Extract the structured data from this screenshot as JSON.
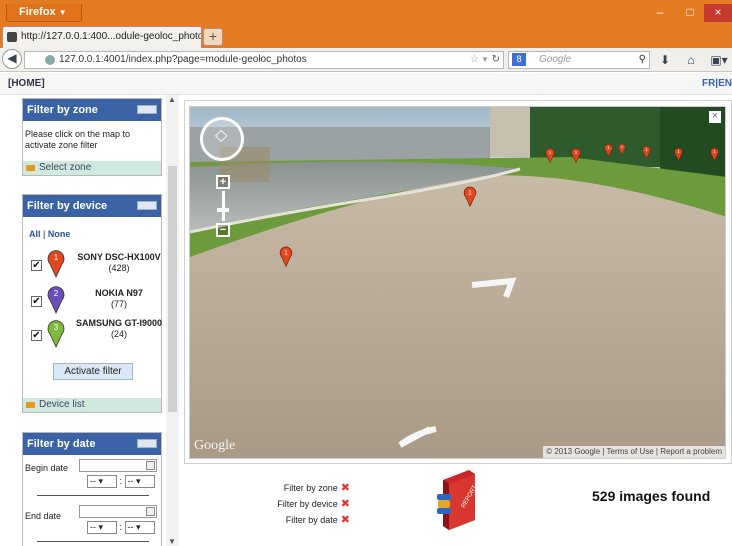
{
  "browser": {
    "app_button": "Firefox",
    "tab_title": "http://127.0.0.1:400...odule-geoloc_photos",
    "new_tab": "+",
    "url": "127.0.0.1:4001/index.php?page=module-geoloc_photos",
    "search_placeholder": "Google",
    "window_controls": {
      "minimize": "–",
      "maximize": "□",
      "close": "×"
    }
  },
  "site": {
    "home_link": "[HOME]",
    "lang_links": "FR|EN"
  },
  "zone_filter": {
    "title": "Filter by zone",
    "text": "Please click on the map to activate zone filter",
    "footer": "Select zone"
  },
  "device_filter": {
    "title": "Filter by device",
    "all": "All",
    "sep": "|",
    "none": "None",
    "devices": [
      {
        "number": "1",
        "name": "SONY DSC-HX100V",
        "count": "(428)",
        "color": "#e4461e",
        "checked": true
      },
      {
        "number": "2",
        "name": "NOKIA N97",
        "count": "(77)",
        "color": "#6b4fb8",
        "checked": true
      },
      {
        "number": "3",
        "name": "SAMSUNG GT-I9000",
        "count": "(24)",
        "color": "#7fb93a",
        "checked": true
      }
    ],
    "activate_button": "Activate filter",
    "footer": "Device list"
  },
  "date_filter": {
    "title": "Filter by date",
    "begin_label": "Begin date",
    "end_label": "End date",
    "select_placeholder": "--",
    "time_sep": ":"
  },
  "streetview": {
    "close": "×",
    "zoom_in": "+",
    "zoom_out": "−",
    "copyright": "© 2013 Google",
    "terms": "Terms of Use",
    "report": "Report a problem",
    "logo": "Google",
    "marker_label": "1"
  },
  "summary": {
    "filters": [
      {
        "label": "Filter by zone"
      },
      {
        "label": "Filter by device"
      },
      {
        "label": "Filter by date"
      }
    ],
    "remove_icon": "✖",
    "report_icon_text": "REPORT",
    "result": "529 images found"
  },
  "colors": {
    "titlebar": "#e27b22",
    "panel_header": "#3a63a7",
    "panel_footer": "#cfe9de",
    "remove": "#e03530"
  }
}
